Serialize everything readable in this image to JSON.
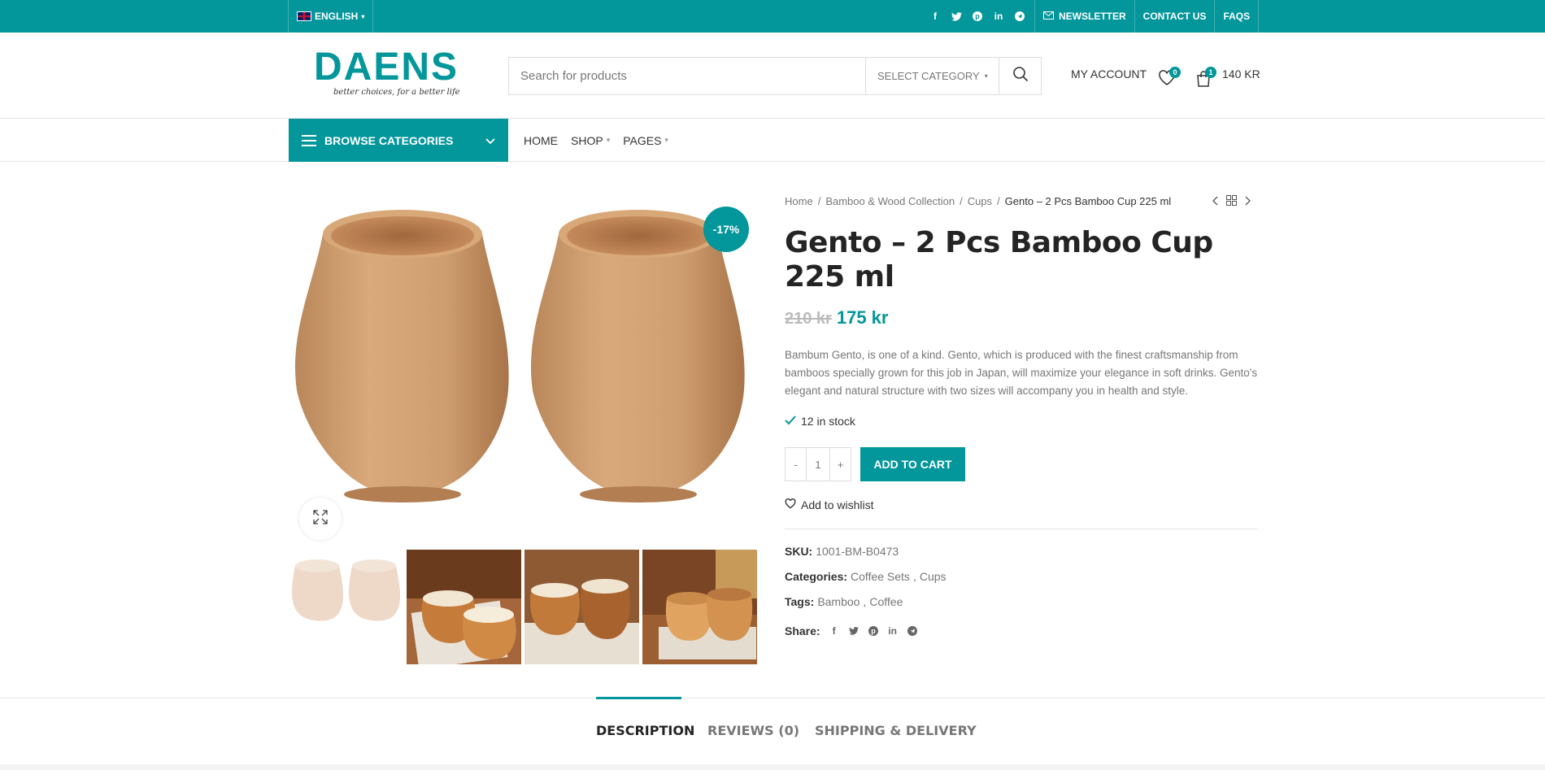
{
  "topbar": {
    "language": "ENGLISH",
    "socials": [
      "facebook-icon",
      "twitter-icon",
      "pinterest-icon",
      "linkedin-icon",
      "telegram-icon"
    ],
    "links": [
      "NEWSLETTER",
      "CONTACT US",
      "FAQS"
    ]
  },
  "header": {
    "logo_title": "DAENS",
    "logo_slogan": "better choices, for a better life",
    "search_placeholder": "Search for products",
    "select_category": "SELECT CATEGORY",
    "my_account": "MY ACCOUNT",
    "wishlist_count": "0",
    "cart_count": "1",
    "cart_total": "140 KR"
  },
  "nav": {
    "browse": "BROWSE CATEGORIES",
    "items": [
      "HOME",
      "SHOP",
      "PAGES"
    ]
  },
  "product": {
    "sale_badge": "-17%",
    "breadcrumb": [
      "Home",
      "Bamboo & Wood Collection",
      "Cups",
      "Gento – 2 Pcs Bamboo Cup 225 ml"
    ],
    "title": "Gento – 2 Pcs Bamboo Cup 225 ml",
    "old_price": "210 kr",
    "new_price": "175 kr",
    "description": "Bambum Gento, is one of a kind. Gento, which is produced with the finest craftsmanship from bamboos specially grown for this job in Japan, will maximize your elegance in soft drinks. Gento's elegant and natural structure with two sizes will accompany you in health and style.",
    "stock": "12 in stock",
    "qty_minus": "-",
    "qty_value": "1",
    "qty_plus": "+",
    "add_to_cart": "ADD TO CART",
    "add_wishlist": "Add to wishlist",
    "sku_label": "SKU:",
    "sku": "1001-BM-B0473",
    "categories_label": "Categories:",
    "categories": [
      "Coffee Sets",
      "Cups"
    ],
    "tags_label": "Tags:",
    "tags": [
      "Bamboo",
      "Coffee"
    ],
    "share_label": "Share:"
  },
  "tabs": [
    "DESCRIPTION",
    "REVIEWS (0)",
    "SHIPPING & DELIVERY"
  ],
  "colors": {
    "accent": "#03969a"
  }
}
